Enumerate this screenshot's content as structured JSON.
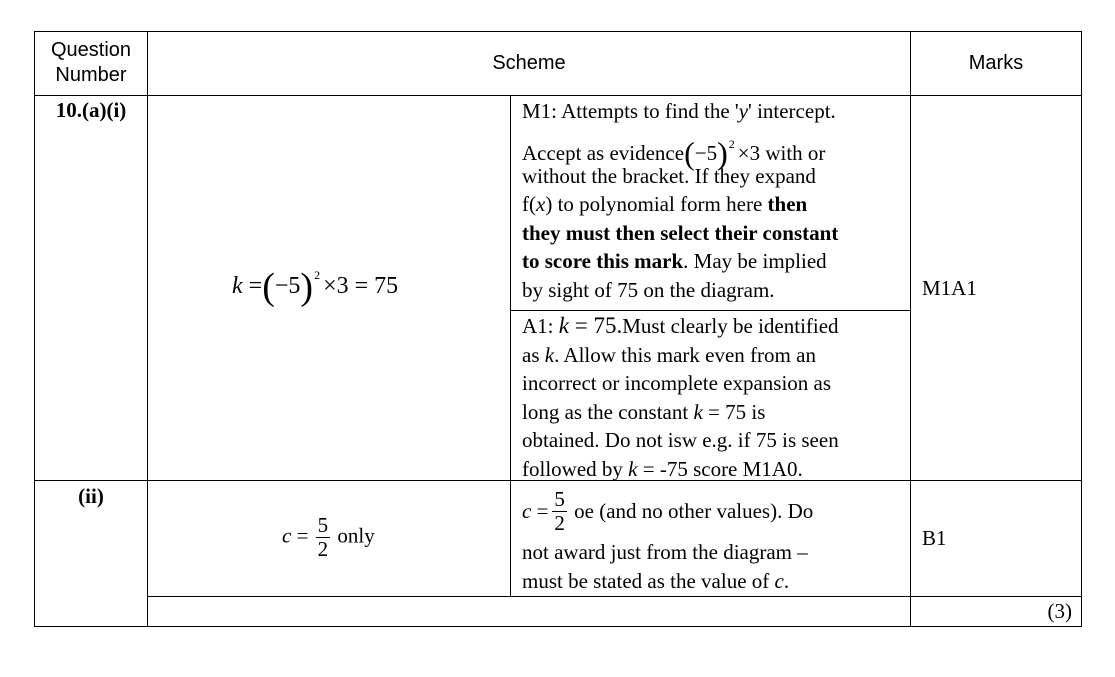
{
  "header": {
    "question_number": "Question Number",
    "scheme": "Scheme",
    "marks": "Marks"
  },
  "rows": [
    {
      "label": "10.(a)(i)",
      "answer": {
        "k": "k",
        "eq1": "=",
        "base": "−5",
        "exp": "2",
        "times": "×",
        "three": "3",
        "eq2": "=",
        "result": "75"
      },
      "notes": [
        {
          "lines": [
            [
              "M1: Attempts to find the '",
              "y",
              "' intercept."
            ],
            [
              "Accept as evidence",
              "−5",
              "2",
              "×3",
              " with or"
            ],
            [
              "without the bracket. If they expand"
            ],
            [
              "f(",
              "x",
              ") to polynomial form here ",
              "then"
            ],
            [
              "they must then select their constant"
            ],
            [
              "to score this mark",
              ". May be implied"
            ],
            [
              "by sight of 75 on the diagram."
            ]
          ]
        },
        {
          "lines": [
            [
              "A1:  ",
              "k",
              " = 75.",
              "Must clearly be identified"
            ],
            [
              "as ",
              "k",
              ". Allow this mark even from an"
            ],
            [
              "incorrect or incomplete expansion as"
            ],
            [
              "long as the constant ",
              "k",
              " = 75 is"
            ],
            [
              "obtained. Do not isw e.g. if 75 is seen"
            ],
            [
              "followed by ",
              "k",
              " = -75 score M1A0."
            ]
          ]
        }
      ],
      "marks": "M1A1"
    },
    {
      "label": "(ii)",
      "answer": {
        "c": "c",
        "eq": "=",
        "num": "5",
        "den": "2",
        "suffix": " only"
      },
      "notes": [
        {
          "lines": [
            [
              "c",
              "=",
              "5",
              "2",
              " oe (and no other values). Do"
            ],
            [
              "not award just from the diagram –"
            ],
            [
              "must be stated as the value of ",
              "c",
              "."
            ]
          ]
        }
      ],
      "marks": "B1"
    }
  ],
  "total": "(3)"
}
